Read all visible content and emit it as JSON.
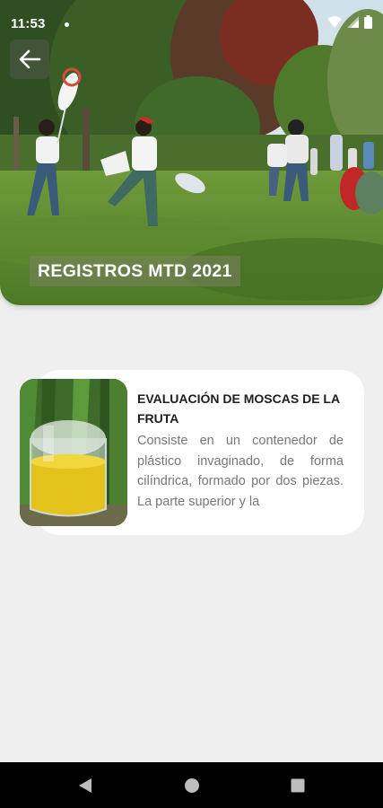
{
  "status_bar": {
    "time": "11:53",
    "icons": [
      "wifi-icon",
      "signal-icon",
      "battery-icon"
    ]
  },
  "header": {
    "back_icon": "arrow-left-icon",
    "title": "REGISTROS MTD 2021"
  },
  "items": [
    {
      "title": "EVALUACIÓN DE MOSCAS DE LA FRUTA",
      "description": "Consiste en un contenedor de plástico invaginado, de forma cilíndrica, formado por dos piezas. La parte superior y  la",
      "thumbnail": "fruit-fly-trap-photo"
    }
  ],
  "nav_bar": {
    "buttons": [
      "back-triangle-icon",
      "home-circle-icon",
      "recents-square-icon"
    ]
  },
  "colors": {
    "background": "#efefef",
    "card": "#ffffff",
    "title_text": "#1e1e1e",
    "body_text": "#777777",
    "nav_bar": "#000000"
  }
}
